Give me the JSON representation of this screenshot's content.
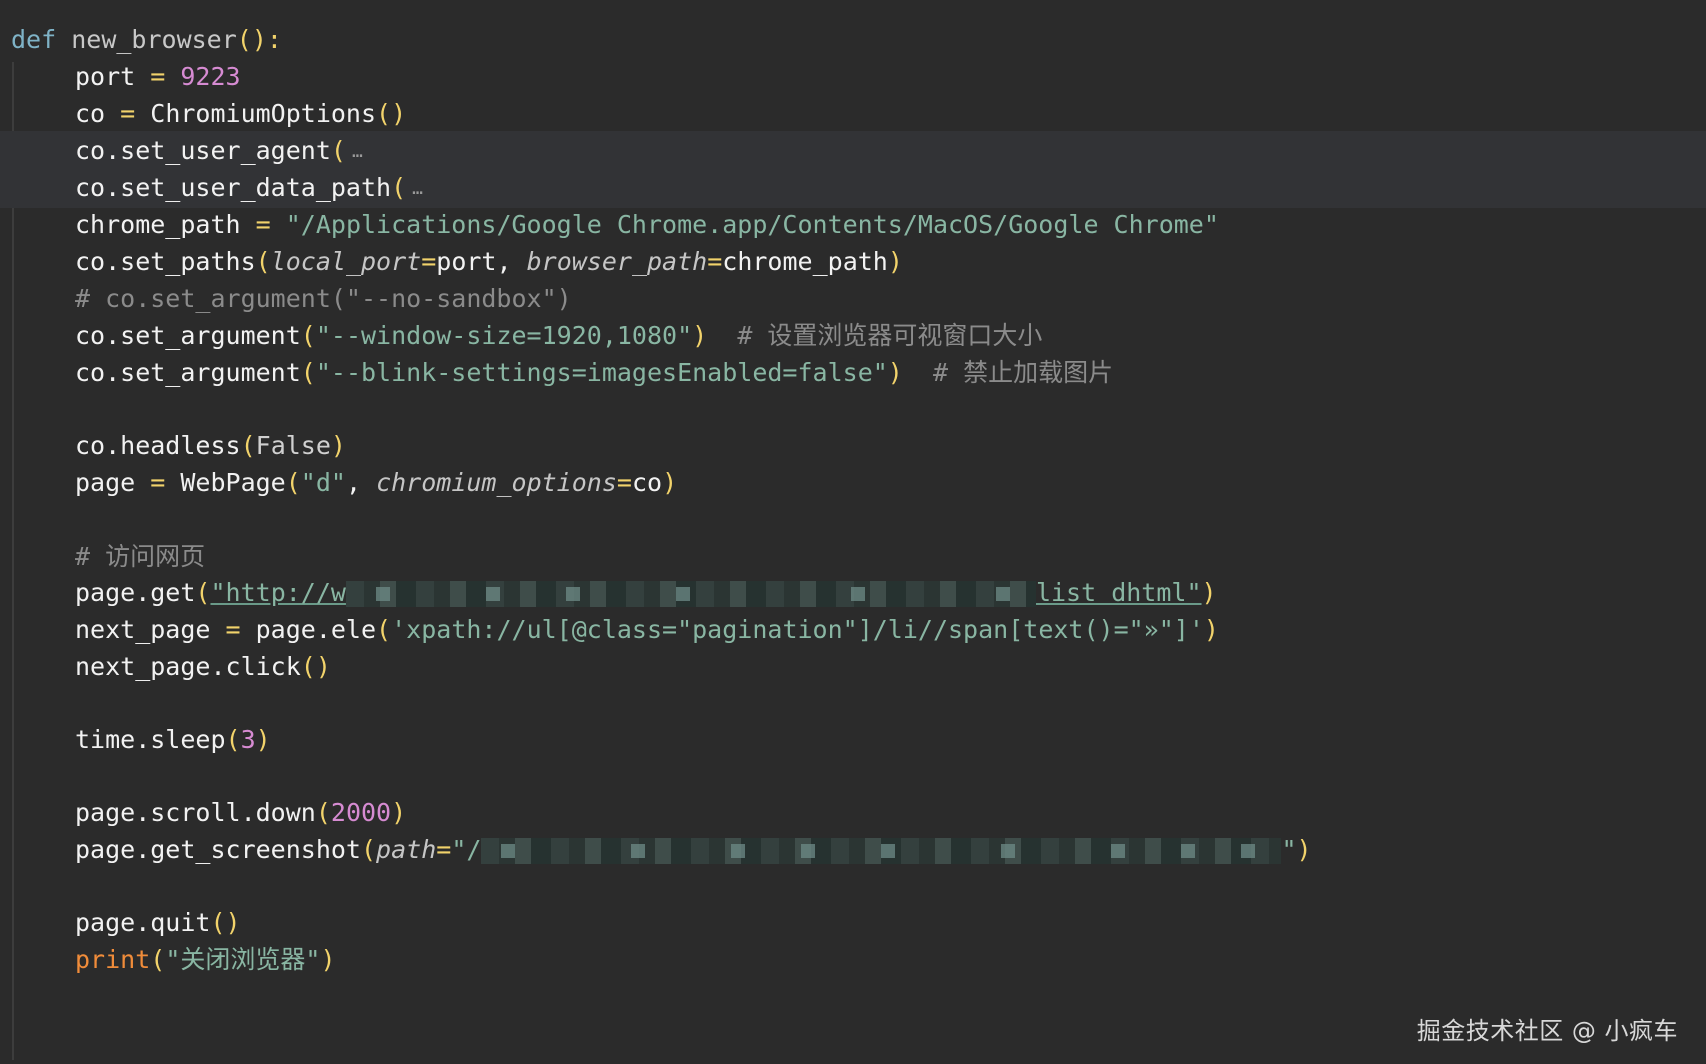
{
  "code": {
    "def_kw": "def",
    "func_name": "new_browser",
    "open_paren": "(",
    "close_paren_colon": "):",
    "line_port_name": "port",
    "line_port_eq": " = ",
    "line_port_value": "9223",
    "line_co_name": "co",
    "line_co_eq": " = ",
    "line_co_class": "ChromiumOptions",
    "parens": "()",
    "set_user_agent": "co.set_user_agent",
    "set_user_data_path": "co.set_user_data_path",
    "fold_marker": "…",
    "chrome_path_name": "chrome_path",
    "chrome_path_value": "\"/Applications/Google Chrome.app/Contents/MacOS/Google Chrome\"",
    "set_paths": "co.set_paths",
    "param_local_port": "local_port",
    "param_browser_path": "browser_path",
    "arg_port": "port",
    "arg_chrome_path": "chrome_path",
    "comment_no_sandbox": "# co.set_argument(\"--no-sandbox\")",
    "set_argument": "co.set_argument",
    "arg_window_size": "\"--window-size=1920,1080\"",
    "comment_window_size": "# 设置浏览器可视窗口大小",
    "arg_blink": "\"--blink-settings=imagesEnabled=false\"",
    "comment_blink": "# 禁止加载图片",
    "headless_call": "co.headless",
    "false_kw": "False",
    "page_name": "page",
    "webpage_class": "WebPage",
    "webpage_mode": "\"d\"",
    "param_chromium_options": "chromium_options",
    "arg_co": "co",
    "comment_visit": "# 访问网页",
    "page_get": "page.get",
    "url_start": "\"http://w",
    "url_end": "list dhtml\"",
    "next_page_name": "next_page",
    "page_ele": "page.ele",
    "xpath_arg": "'xpath://ul[@class=\"pagination\"]/li//span[text()=\"»\"]'",
    "next_page_click": "next_page.click",
    "time_sleep": "time.sleep",
    "sleep_value": "3",
    "page_scroll": "page.scroll.down",
    "scroll_value": "2000",
    "page_screenshot": "page.get_screenshot",
    "param_path": "path",
    "screenshot_path_start": "\"/",
    "screenshot_path_end": "\"",
    "page_quit": "page.quit",
    "print_fn": "print",
    "print_arg": "\"关闭浏览器\""
  },
  "watermark": "掘金技术社区 @ 小疯车"
}
